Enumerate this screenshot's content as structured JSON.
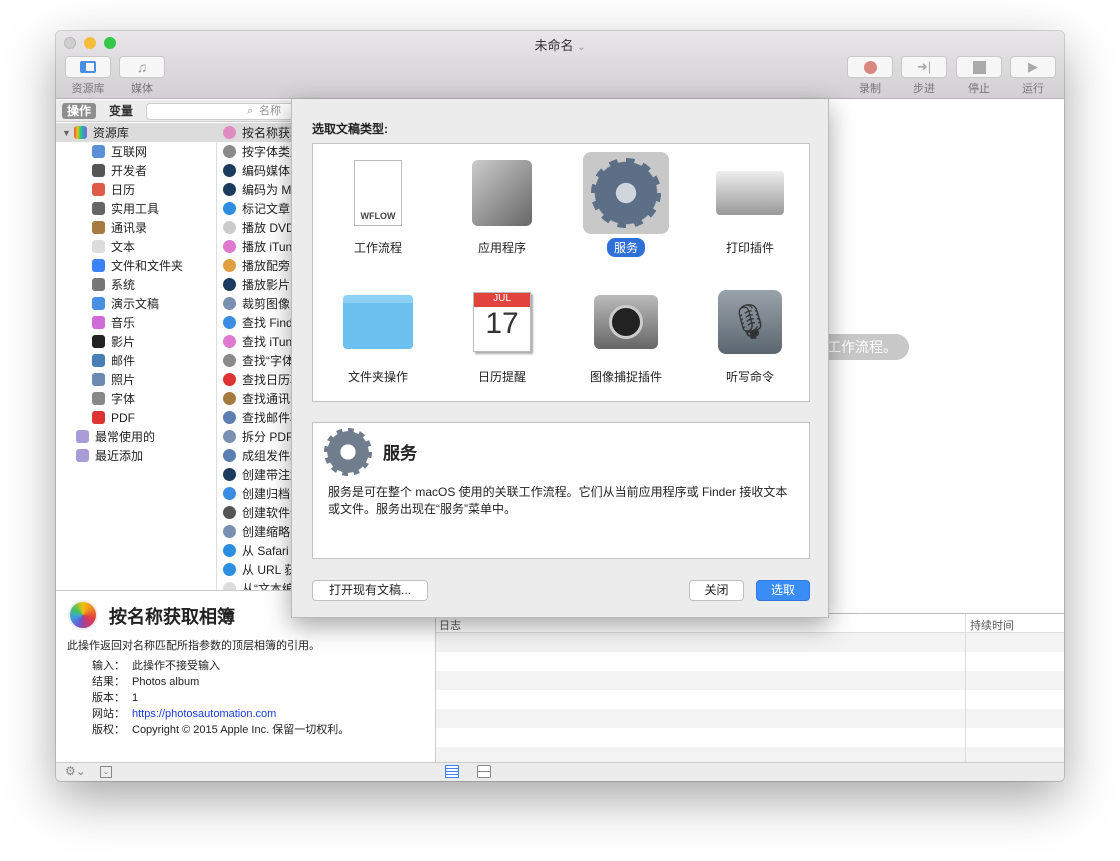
{
  "window": {
    "title": "未命名"
  },
  "toolbar": {
    "left": [
      {
        "label": "资源库",
        "icon": "sidebar-icon"
      },
      {
        "label": "媒体",
        "icon": "media-icon"
      }
    ],
    "right": [
      {
        "label": "录制",
        "icon": "record-icon"
      },
      {
        "label": "步进",
        "icon": "step-icon"
      },
      {
        "label": "停止",
        "icon": "stop-icon"
      },
      {
        "label": "运行",
        "icon": "run-icon"
      }
    ]
  },
  "library": {
    "tab_actions": "操作",
    "tab_variables": "变量",
    "search_placeholder": "名称",
    "root": "资源库",
    "categories": [
      "互联网",
      "开发者",
      "日历",
      "实用工具",
      "通讯录",
      "文本",
      "文件和文件夹",
      "系统",
      "演示文稿",
      "音乐",
      "影片",
      "邮件",
      "照片",
      "字体",
      "PDF"
    ],
    "smart": [
      "最常使用的",
      "最近添加"
    ]
  },
  "actions": [
    "按名称获取",
    "按字体类型",
    "编码媒体",
    "编码为 MP",
    "标记文章",
    "播放 DVD",
    "播放 iTun",
    "播放配旁白",
    "播放影片",
    "裁剪图像",
    "查找 Find",
    "查找 iTun",
    "查找“字体",
    "查找日历项",
    "查找通讯录",
    "查找邮件项",
    "拆分 PDF",
    "成组发件箱",
    "创建带注解",
    "创建归档",
    "创建软件包",
    "创建缩略图",
    "从 Safari",
    "从 URL 获",
    "从“文本编"
  ],
  "description": {
    "title": "按名称获取相簿",
    "summary": "此操作返回对名称匹配所指参数的顶层相簿的引用。",
    "fields": [
      {
        "k": "输入：",
        "v": "此操作不接受输入"
      },
      {
        "k": "结果：",
        "v": "Photos album"
      },
      {
        "k": "版本：",
        "v": "1"
      },
      {
        "k": "网站：",
        "v": "https://photosautomation.com"
      },
      {
        "k": "版权：",
        "v": "Copyright © 2015 Apple Inc. 保留一切权利。"
      }
    ]
  },
  "workflow": {
    "hint": "工作流程。"
  },
  "log": {
    "col_log": "日志",
    "col_duration": "持续时间"
  },
  "dialog": {
    "title": "选取文稿类型:",
    "types": [
      {
        "label": "工作流程",
        "badge": "WFLOW"
      },
      {
        "label": "应用程序"
      },
      {
        "label": "服务"
      },
      {
        "label": "打印插件"
      },
      {
        "label": "文件夹操作"
      },
      {
        "label": "日历提醒",
        "month": "JUL",
        "day": "17"
      },
      {
        "label": "图像捕捉插件"
      },
      {
        "label": "听写命令"
      }
    ],
    "selected": "服务",
    "info_title": "服务",
    "info_text": "服务是可在整个 macOS 使用的关联工作流程。它们从当前应用程序或 Finder 接收文本或文件。服务出现在“服务”菜单中。",
    "open_existing": "打开现有文稿...",
    "close": "关闭",
    "choose": "选取"
  },
  "colors": {
    "accent": "#2e7cf6",
    "link": "#1a3be0"
  }
}
